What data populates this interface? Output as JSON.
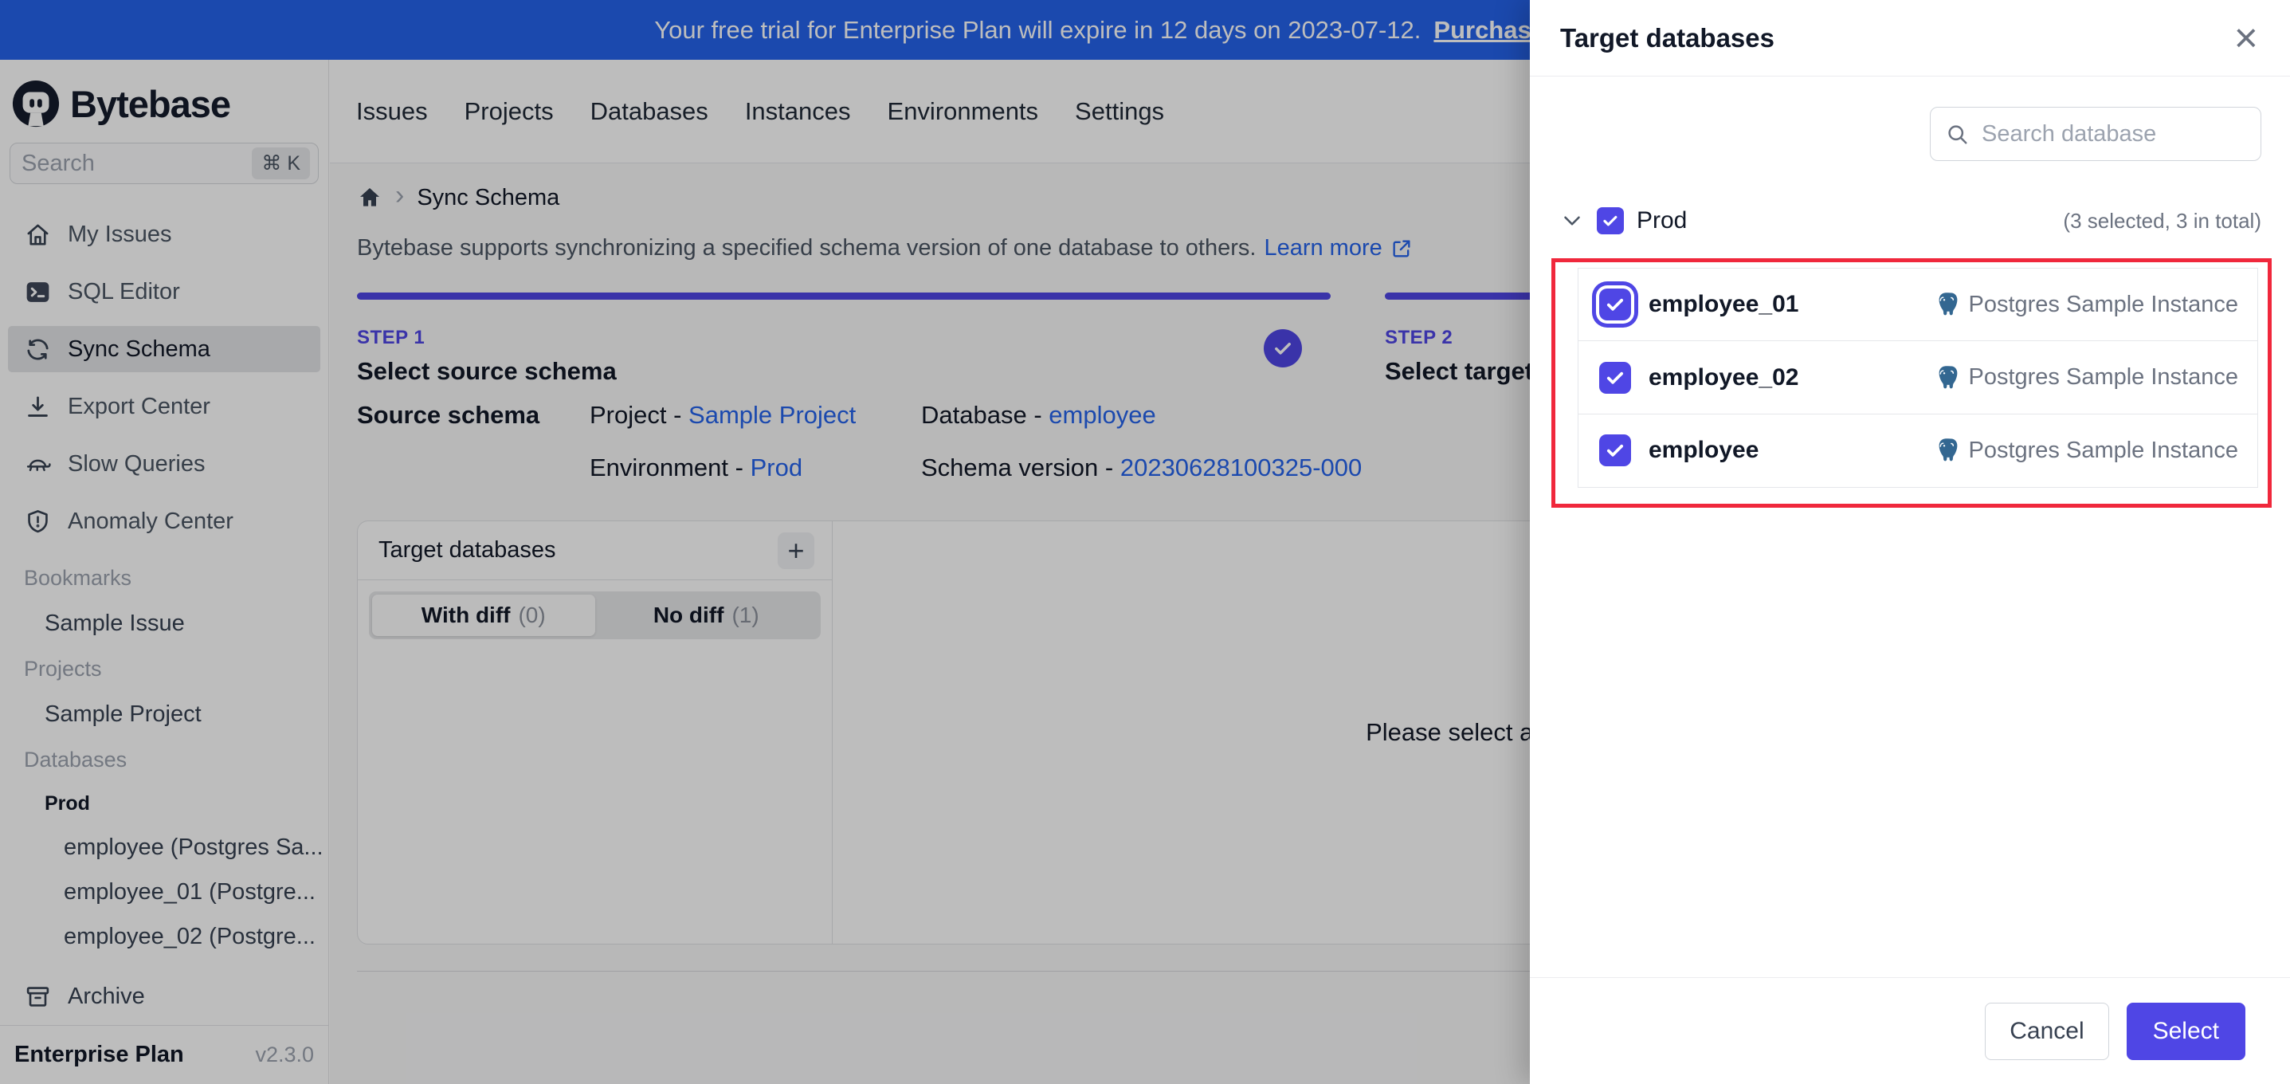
{
  "banner": {
    "message": "Your free trial for Enterprise Plan will expire in 12 days on 2023-07-12.",
    "link_label": "Purchase license"
  },
  "brand": {
    "name": "Bytebase"
  },
  "topnav": {
    "items": [
      {
        "label": "Issues"
      },
      {
        "label": "Projects"
      },
      {
        "label": "Databases"
      },
      {
        "label": "Instances"
      },
      {
        "label": "Environments"
      },
      {
        "label": "Settings"
      }
    ]
  },
  "sidebar": {
    "search": {
      "placeholder": "Search",
      "shortcut": "⌘ K"
    },
    "menu": [
      {
        "label": "My Issues"
      },
      {
        "label": "SQL Editor"
      },
      {
        "label": "Sync Schema"
      },
      {
        "label": "Export Center"
      },
      {
        "label": "Slow Queries"
      },
      {
        "label": "Anomaly Center"
      }
    ],
    "bookmarks": {
      "title": "Bookmarks",
      "items": [
        {
          "label": "Sample Issue"
        }
      ]
    },
    "projects": {
      "title": "Projects",
      "items": [
        {
          "label": "Sample Project"
        }
      ]
    },
    "databases": {
      "title": "Databases",
      "group": "Prod",
      "items": [
        {
          "label": "employee (Postgres Sa..."
        },
        {
          "label": "employee_01 (Postgre..."
        },
        {
          "label": "employee_02 (Postgre..."
        }
      ]
    },
    "archive": {
      "label": "Archive"
    },
    "footer": {
      "plan": "Enterprise Plan",
      "version": "v2.3.0"
    }
  },
  "page": {
    "breadcrumb": {
      "current": "Sync Schema"
    },
    "intro": {
      "text": "Bytebase supports synchronizing a specified schema version of one database to others.",
      "link_label": "Learn more"
    },
    "steps": [
      {
        "eyebrow": "STEP 1",
        "title": "Select source schema"
      },
      {
        "eyebrow": "STEP 2",
        "title": "Select target databases"
      }
    ],
    "source": {
      "label": "Source schema",
      "fields": [
        {
          "key": "Project -",
          "value": "Sample Project"
        },
        {
          "key": "Database -",
          "value": "employee"
        },
        {
          "key": "Environment -",
          "value": "Prod"
        },
        {
          "key": "Schema version -",
          "value": "20230628100325-000"
        }
      ]
    },
    "panel": {
      "title": "Target databases",
      "add_label": "+",
      "tabs": [
        {
          "label": "With diff",
          "count": "(0)"
        },
        {
          "label": "No diff",
          "count": "(1)"
        }
      ],
      "empty_message": "Please select a target database first"
    }
  },
  "drawer": {
    "title": "Target databases",
    "close_label": "×",
    "search": {
      "placeholder": "Search database"
    },
    "group": {
      "label": "Prod",
      "summary": "(3 selected, 3 in total)"
    },
    "rows": [
      {
        "name": "employee_01",
        "instance": "Postgres Sample Instance"
      },
      {
        "name": "employee_02",
        "instance": "Postgres Sample Instance"
      },
      {
        "name": "employee",
        "instance": "Postgres Sample Instance"
      }
    ],
    "footer": {
      "cancel_label": "Cancel",
      "select_label": "Select"
    }
  },
  "colors": {
    "accent": "#4f46e5",
    "banner_blue": "#2563eb",
    "link_blue": "#2563eb",
    "highlight_red": "#f0283c"
  }
}
